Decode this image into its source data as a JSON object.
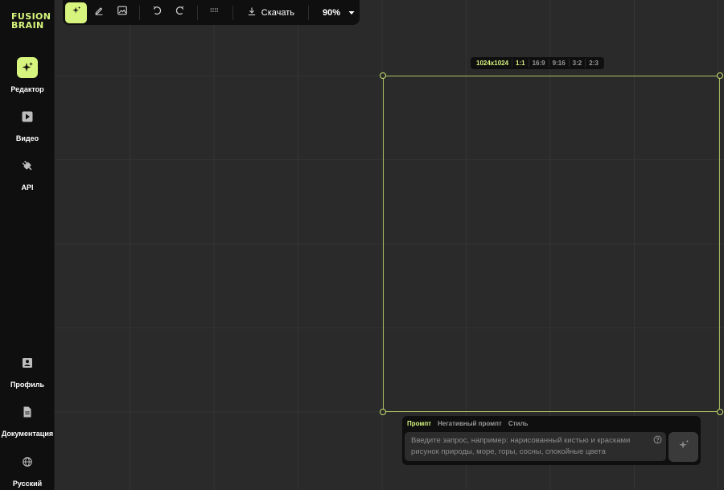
{
  "app": {
    "logo_line1": "FUSION",
    "logo_line2": "BRAIN",
    "accent_color": "#d7f57e"
  },
  "sidebar": {
    "items": [
      {
        "label": "Редактор",
        "icon": "sparkle-icon",
        "active": true
      },
      {
        "label": "Видео",
        "icon": "play-icon",
        "active": false
      },
      {
        "label": "API",
        "icon": "plug-icon",
        "active": false
      },
      {
        "label": "Профиль",
        "icon": "profile-icon",
        "active": false
      },
      {
        "label": "Документация",
        "icon": "document-icon",
        "active": false
      },
      {
        "label": "Русский",
        "icon": "globe-icon",
        "active": false
      }
    ]
  },
  "toolbar": {
    "tools": [
      {
        "icon": "sparkle-icon",
        "active": true
      },
      {
        "icon": "eraser-icon",
        "active": false
      },
      {
        "icon": "image-icon",
        "active": false
      },
      {
        "icon": "undo-icon",
        "active": false
      },
      {
        "icon": "redo-icon",
        "active": false
      },
      {
        "icon": "grid-dots-icon",
        "active": false
      }
    ],
    "download_label": "Скачать",
    "download_icon": "download-icon",
    "zoom": "90%",
    "zoom_icon": "caret-down-icon"
  },
  "canvas": {
    "frame_size": "1024x1024",
    "ratios": [
      "1:1",
      "16:9",
      "9:16",
      "3:2",
      "2:3"
    ],
    "active_ratio": "1:1"
  },
  "prompt": {
    "tabs": [
      "Промпт",
      "Негативный промпт",
      "Стиль"
    ],
    "active_tab": "Промпт",
    "placeholder": "Введите запрос, например: нарисованный кистью и красками рисунок природы, море, горы, сосны, спокойные цвета",
    "help_icon": "help-circle-icon",
    "generate_icon": "sparkle-icon"
  }
}
